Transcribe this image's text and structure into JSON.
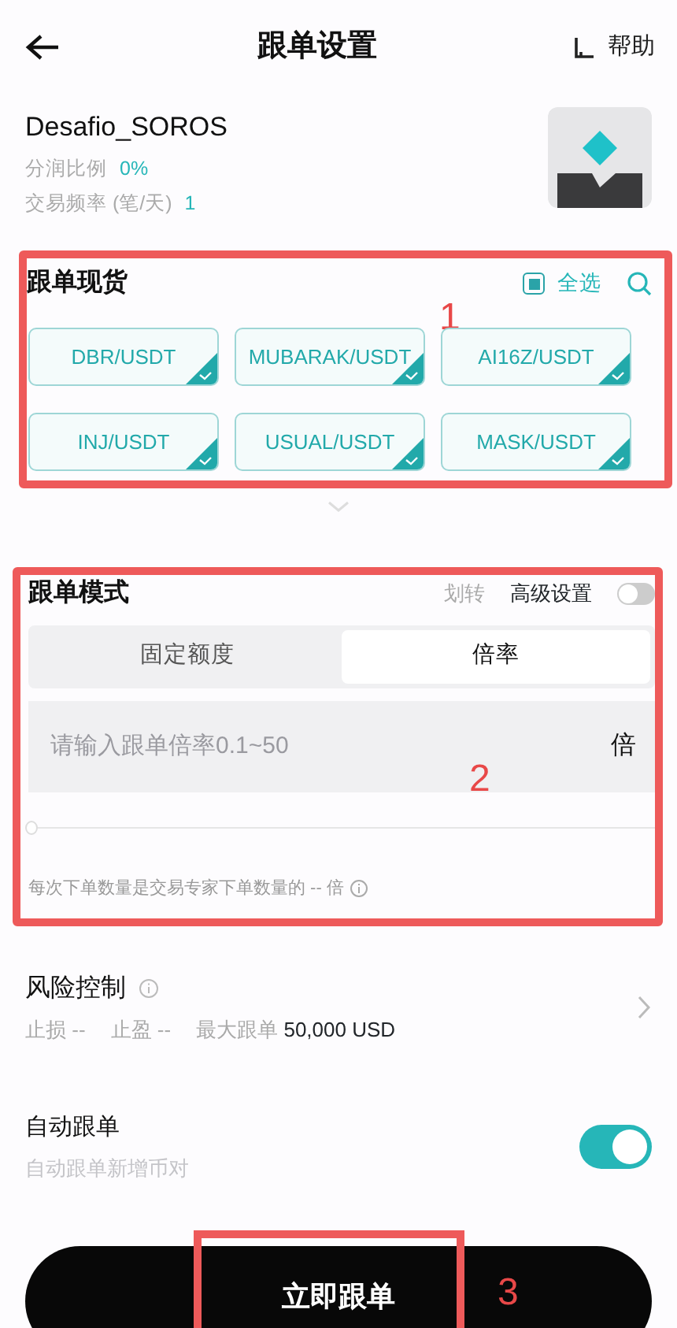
{
  "header": {
    "title": "跟单设置",
    "help": "帮助"
  },
  "trader": {
    "name": "Desafio_SOROS",
    "stats": [
      {
        "label": "分润比例",
        "value": "0%"
      },
      {
        "label": "交易频率 (笔/天)",
        "value": "1"
      }
    ]
  },
  "pairs_section": {
    "annotation": "1",
    "title": "跟单现货",
    "select_all": {
      "label": "全选",
      "checked": true
    },
    "pairs": [
      {
        "label": "DBR/USDT",
        "selected": true
      },
      {
        "label": "MUBARAK/USDT",
        "selected": true
      },
      {
        "label": "AI16Z/USDT",
        "selected": true
      },
      {
        "label": "INJ/USDT",
        "selected": true
      },
      {
        "label": "USUAL/USDT",
        "selected": true
      },
      {
        "label": "MASK/USDT",
        "selected": true
      }
    ]
  },
  "mode_section": {
    "annotation": "2",
    "title": "跟单模式",
    "transfer": "划转",
    "advanced": {
      "label": "高级设置",
      "on": false
    },
    "tabs": [
      {
        "label": "固定额度",
        "selected": false
      },
      {
        "label": "倍率",
        "selected": true
      }
    ],
    "input": {
      "placeholder": "请输入跟单倍率0.1~50",
      "unit": "倍"
    },
    "slider": {
      "level": 0
    },
    "note": "每次下单数量是交易专家下单数量的 -- 倍"
  },
  "risk": {
    "title": "风险控制",
    "items": [
      {
        "label": "止损",
        "value": "--"
      },
      {
        "label": "止盈",
        "value": "--"
      },
      {
        "label": "最大跟单",
        "value": "50,000 USD"
      }
    ]
  },
  "auto_follow": {
    "title": "自动跟单",
    "subtitle": "自动跟单新增币对",
    "on": true
  },
  "submit": {
    "label": "立即跟单",
    "annotation": "3"
  }
}
